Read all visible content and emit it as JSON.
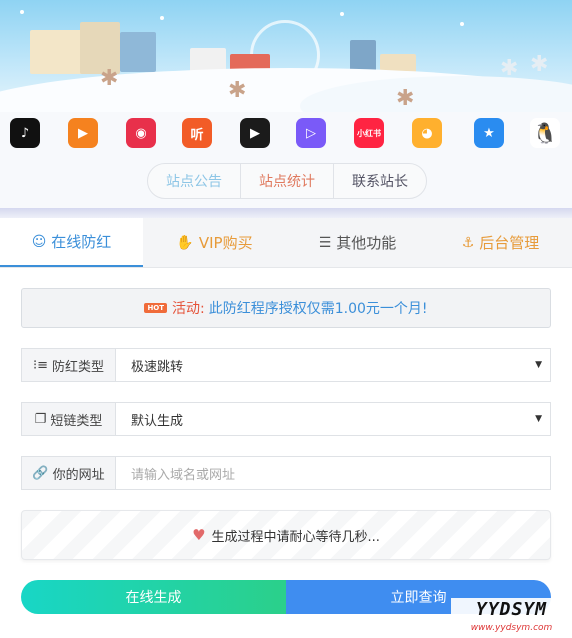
{
  "apps": [
    {
      "icon": "tiktok-icon",
      "color": "#111111",
      "glyph": "♪"
    },
    {
      "icon": "kuaishou-icon",
      "color": "#f5821f",
      "glyph": "▶"
    },
    {
      "icon": "quanmin-icon",
      "color": "#e8304b",
      "glyph": "◉"
    },
    {
      "icon": "ting-icon",
      "color": "#f25c27",
      "glyph": "听"
    },
    {
      "icon": "video-play-icon",
      "color": "#1b1b1b",
      "glyph": "▶"
    },
    {
      "icon": "weishi-icon",
      "color": "#7a5af8",
      "glyph": "▷"
    },
    {
      "icon": "xiaohongshu-icon",
      "color": "#ff2442",
      "glyph": "小红书"
    },
    {
      "icon": "weibo-icon",
      "color": "#ffb02e",
      "glyph": "◕"
    },
    {
      "icon": "qzone-icon",
      "color": "#2a8cf0",
      "glyph": "★"
    },
    {
      "icon": "qq-icon",
      "color": "#ffffff",
      "glyph": "🐧"
    }
  ],
  "notice_tabs": [
    "站点公告",
    "站点统计",
    "联系站长"
  ],
  "tabs": [
    {
      "label": "在线防红",
      "icon": "smile-icon",
      "glyph": "☺"
    },
    {
      "label": "VIP购买",
      "icon": "thumbs-up-icon",
      "glyph": "👍"
    },
    {
      "label": "其他功能",
      "icon": "menu-icon",
      "glyph": "☰"
    },
    {
      "label": "后台管理",
      "icon": "anchor-icon",
      "glyph": "⚓"
    }
  ],
  "activity": {
    "hot": "HOT",
    "label": "活动:",
    "text": "此防红程序授权仅需1.00元一个月!"
  },
  "form": {
    "redirect_type_label": "防红类型",
    "redirect_type_value": "极速跳转",
    "short_link_label": "短链类型",
    "short_link_value": "默认生成",
    "url_label": "你的网址",
    "url_placeholder": "请输入域名或网址"
  },
  "progress_text": "生成过程中请耐心等待几秒...",
  "buttons": {
    "generate": "在线生成",
    "query": "立即查询"
  },
  "watermark": {
    "big": "YYDSYM",
    "small": "www.yydsym.com"
  }
}
